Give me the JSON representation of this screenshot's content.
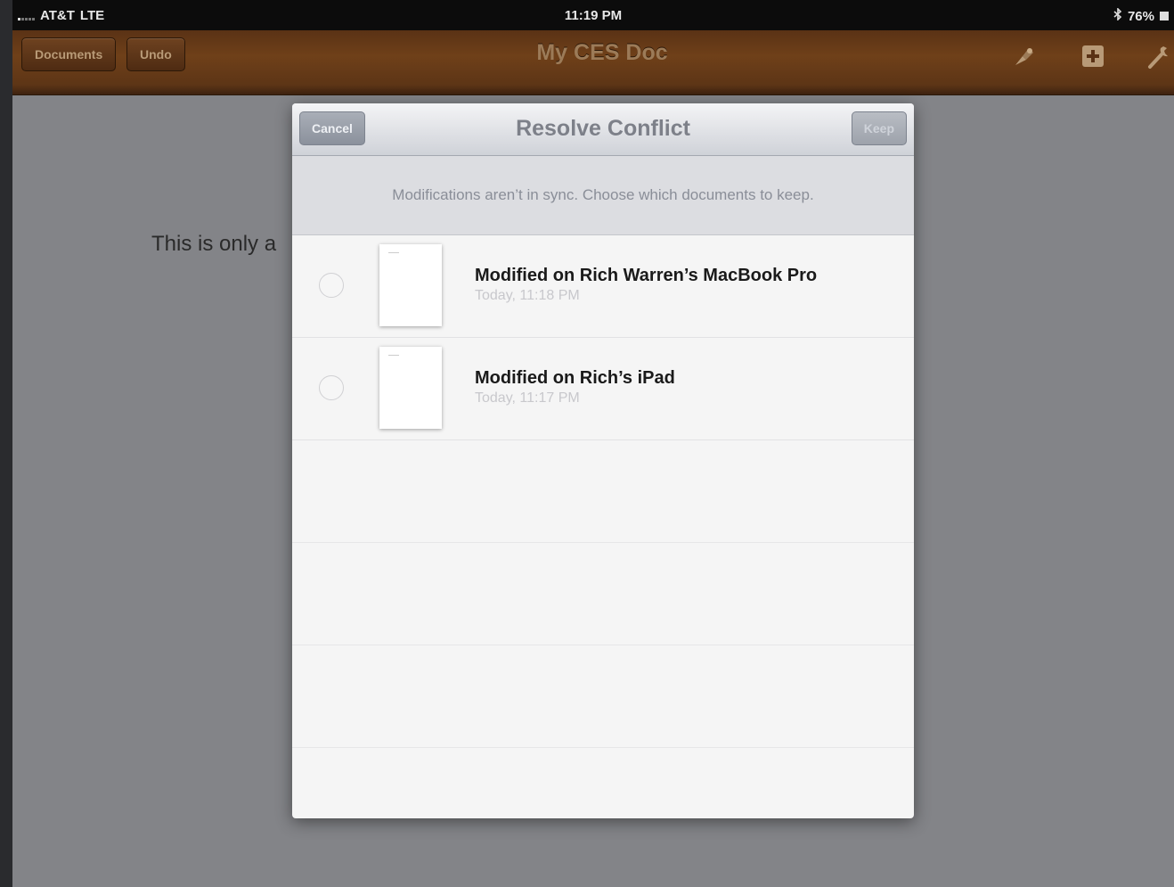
{
  "status_bar": {
    "carrier": "AT&T",
    "network": "LTE",
    "time": "11:19 PM",
    "battery": "76%"
  },
  "toolbar": {
    "documents_label": "Documents",
    "undo_label": "Undo",
    "title": "My CES Doc",
    "icons": [
      "paintbrush-icon",
      "add-media-icon",
      "wrench-icon"
    ]
  },
  "document": {
    "visible_text": "This is only a"
  },
  "modal": {
    "cancel_label": "Cancel",
    "title": "Resolve Conflict",
    "keep_label": "Keep",
    "message": "Modifications aren’t in sync. Choose which documents to keep.",
    "versions": [
      {
        "title": "Modified on Rich Warren’s MacBook Pro",
        "date": "Today, 11:18 PM",
        "selected": false
      },
      {
        "title": "Modified on Rich’s iPad",
        "date": "Today, 11:17 PM",
        "selected": false
      }
    ]
  },
  "colors": {
    "toolbar_brown": "#6f4019",
    "toolbar_text": "#b89a77",
    "modal_nav": "#cfd2d8",
    "backdrop": "#838488"
  }
}
